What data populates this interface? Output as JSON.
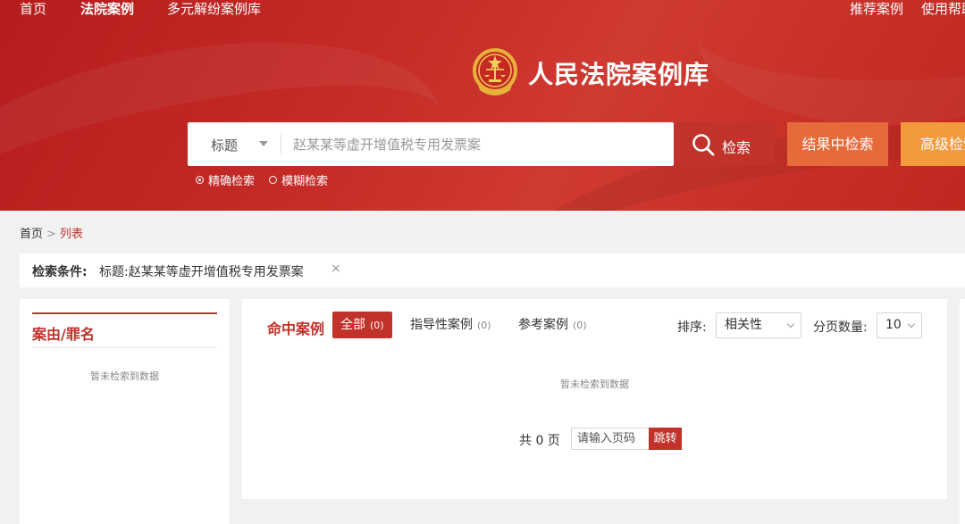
{
  "nav": {
    "home": "首页",
    "court_cases": "法院案例",
    "dispute_cases": "多元解纷案例库",
    "recommended": "推荐案例",
    "help": "使用帮助"
  },
  "site": {
    "title": "人民法院案例库"
  },
  "search": {
    "field": "标题",
    "placeholder": "赵某某等虚开增值税专用发票案",
    "search_label": "检索",
    "within_label": "结果中检索",
    "advanced_label": "高级检索",
    "modes": [
      "精确检索",
      "模糊检索"
    ],
    "selected_mode": "精确检索"
  },
  "breadcrumb": {
    "home": "首页",
    "sep": ">",
    "current": "列表"
  },
  "condition": {
    "label": "检索条件:",
    "value": "标题:赵某某等虚开增值税专用发票案",
    "remove": "×"
  },
  "sidebar": {
    "title": "案由/罪名",
    "empty": "暂未检索到数据"
  },
  "results": {
    "heading": "命中案例",
    "tabs": [
      {
        "label": "全部",
        "count": "(0)"
      },
      {
        "label": "指导性案例",
        "count": "(0)"
      },
      {
        "label": "参考案例",
        "count": "(0)"
      }
    ],
    "sort_label": "排序:",
    "sort_value": "相关性",
    "page_size_label": "分页数量:",
    "page_size_value": "10",
    "empty": "暂未检索到数据",
    "pager": {
      "total": "共 0 页",
      "input_placeholder": "请输入页码",
      "go": "跳转"
    }
  },
  "colors": {
    "primary": "#c0322a",
    "within": "#e76a3a",
    "advanced": "#f29a3c",
    "background": "#f1f1f1"
  }
}
